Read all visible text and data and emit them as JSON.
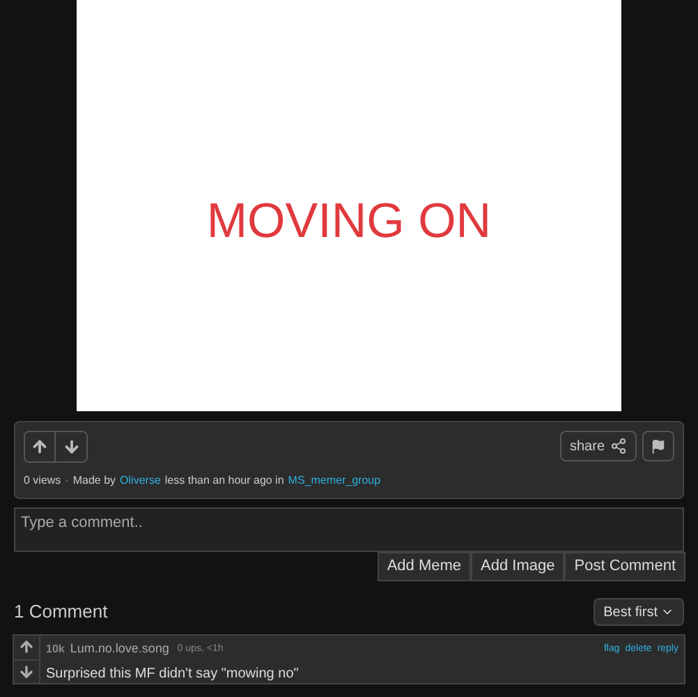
{
  "meme": {
    "caption": "MOVING ON"
  },
  "meta": {
    "views": "0 views",
    "separator": "·",
    "made_by": "Made by",
    "author": "Oliverse",
    "when": "less than an hour ago in",
    "stream": "MS_memer_group",
    "share": "share"
  },
  "comment_box": {
    "placeholder": "Type a comment..",
    "buttons": [
      "Add Meme",
      "Add Image",
      "Post Comment"
    ]
  },
  "comments_header": {
    "count": "1 Comment",
    "sort": "Best first"
  },
  "comments": [
    {
      "points": "10k",
      "user": "Lum.no.love.song",
      "info": "0 ups, <1h",
      "actions": [
        "flag",
        "delete",
        "reply"
      ],
      "text": "Surprised this MF didn't say \"mowing no\""
    }
  ]
}
